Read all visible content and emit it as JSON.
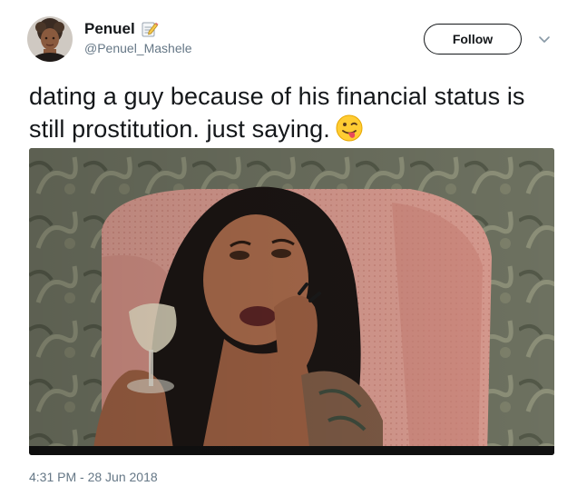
{
  "user": {
    "display_name": "Penuel",
    "handle": "@Penuel_Mashele",
    "avatar": "profile-photo",
    "badge_icon": "memo-icon"
  },
  "header": {
    "follow_label": "Follow",
    "menu_icon": "chevron-down-icon"
  },
  "tweet": {
    "text": "dating a guy because of his financial status is still prostitution. just saying.",
    "emoji": "winking-face-with-tongue-emoji",
    "media": "photo-woman-drinking-wine-in-pink-armchair",
    "timestamp": "4:31 PM - 28 Jun 2018"
  },
  "colors": {
    "text_primary": "#14171a",
    "text_secondary": "#657786",
    "background": "#ffffff"
  }
}
